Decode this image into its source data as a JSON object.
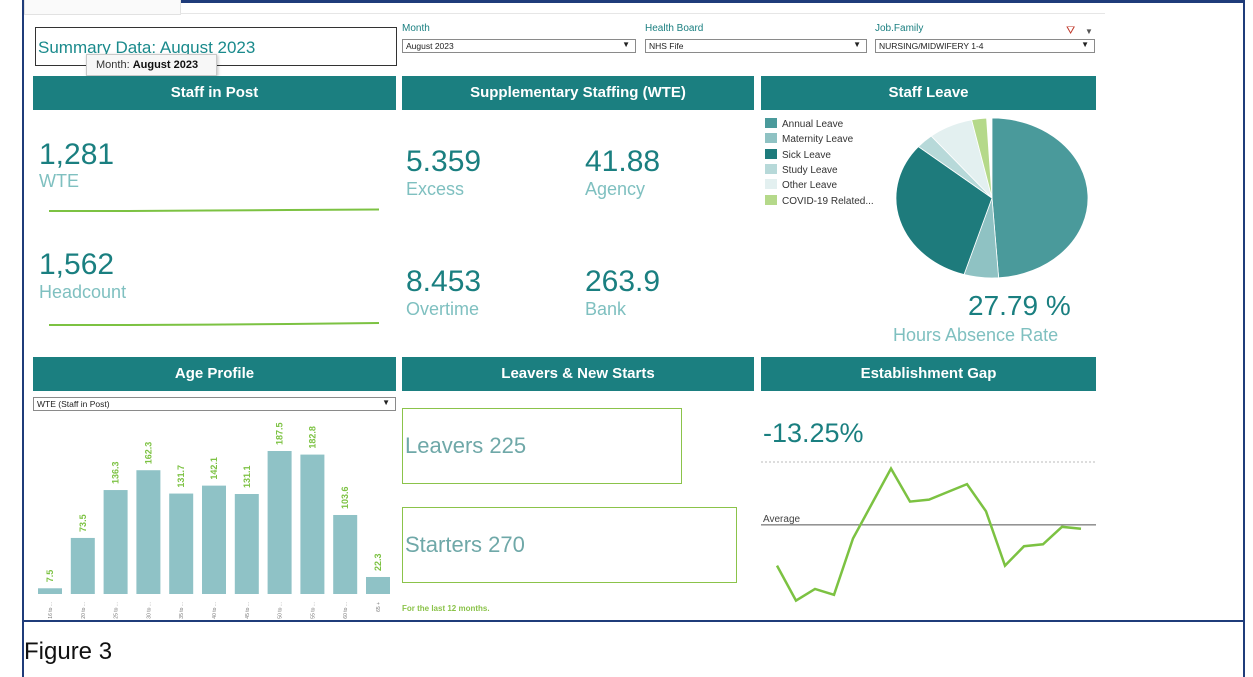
{
  "summary": {
    "title": "Summary Data: August 2023",
    "tooltip_label": "Month:",
    "tooltip_value": "August 2023"
  },
  "filters": {
    "month": {
      "label": "Month",
      "value": "August 2023"
    },
    "health_board": {
      "label": "Health Board",
      "value": "NHS Fife"
    },
    "job_family": {
      "label": "Job.Family",
      "value": "NURSING/MIDWIFERY 1-4"
    }
  },
  "staff_in_post": {
    "header": "Staff in Post",
    "wte_value": "1,281",
    "wte_label": "WTE",
    "headcount_value": "1,562",
    "headcount_label": "Headcount"
  },
  "supplementary": {
    "header": "Supplementary Staffing (WTE)",
    "excess_value": "5.359",
    "excess_label": "Excess",
    "agency_value": "41.88",
    "agency_label": "Agency",
    "overtime_value": "8.453",
    "overtime_label": "Overtime",
    "bank_value": "263.9",
    "bank_label": "Bank"
  },
  "staff_leave": {
    "header": "Staff Leave",
    "legend": [
      {
        "label": "Annual Leave",
        "color": "#4a9a9b"
      },
      {
        "label": "Maternity Leave",
        "color": "#8fc2c3"
      },
      {
        "label": "Sick Leave",
        "color": "#1e7b7c"
      },
      {
        "label": "Study Leave",
        "color": "#b7d9d9"
      },
      {
        "label": "Other Leave",
        "color": "#e3f0f0"
      },
      {
        "label": "COVID-19 Related...",
        "color": "#b5d98a"
      }
    ],
    "slices": [
      0.489,
      0.058,
      0.314,
      0.03,
      0.075,
      0.025
    ],
    "rate_value": "27.79 %",
    "rate_label": "Hours Absence Rate"
  },
  "age_profile": {
    "header": "Age Profile",
    "dropdown": "WTE (Staff in Post)"
  },
  "chart_data": {
    "type": "bar",
    "categories": [
      "16 to ...",
      "20 to ...",
      "25 to ...",
      "30 to ...",
      "35 to ...",
      "40 to ...",
      "45 to ...",
      "50 to ...",
      "55 to ...",
      "60 to ...",
      "65 +"
    ],
    "values": [
      7.5,
      73.5,
      136.3,
      162.3,
      131.7,
      142.1,
      131.1,
      187.5,
      182.8,
      103.6,
      22.3
    ],
    "value_labels": [
      "7.5",
      "73.5",
      "136.3",
      "162.3",
      "131.7",
      "142.1",
      "131.1",
      "187.5",
      "182.8",
      "103.6",
      "22.3"
    ],
    "bar_color": "#8fc2c6",
    "label_color": "#7cc242"
  },
  "leavers": {
    "header": "Leavers & New Starts",
    "leavers_text": "Leavers 225",
    "starters_text": "Starters 270",
    "note": "For the last 12 months."
  },
  "establishment": {
    "header": "Establishment Gap",
    "value": "-13.25%",
    "average_label": "Average",
    "trend": [
      0.78,
      0.6,
      0.66,
      0.63,
      0.92,
      1.1,
      1.28,
      1.11,
      1.12,
      1.16,
      1.2,
      1.06,
      0.78,
      0.88,
      0.89,
      0.98,
      0.97
    ],
    "average": 0.99,
    "line_color": "#7cc242"
  },
  "caption": "Figure 3"
}
